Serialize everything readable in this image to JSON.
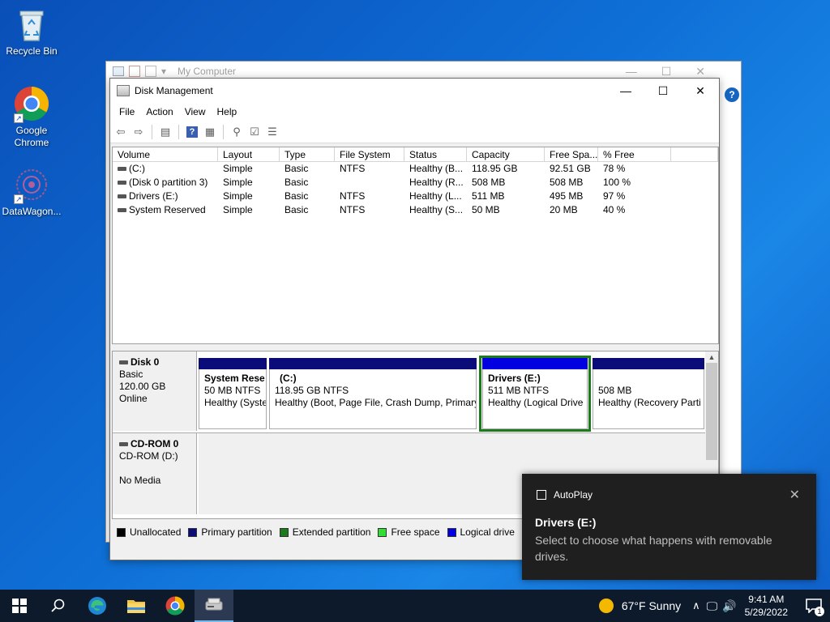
{
  "desktop": {
    "icons": [
      {
        "label": "Recycle Bin"
      },
      {
        "label": "Google Chrome"
      },
      {
        "label": "DataWagon..."
      }
    ]
  },
  "back_window": {
    "title": "My Computer"
  },
  "window": {
    "title": "Disk Management",
    "menu": [
      "File",
      "Action",
      "View",
      "Help"
    ]
  },
  "volumes": {
    "columns": [
      "Volume",
      "Layout",
      "Type",
      "File System",
      "Status",
      "Capacity",
      "Free Spa...",
      "% Free"
    ],
    "rows": [
      [
        "(C:)",
        "Simple",
        "Basic",
        "NTFS",
        "Healthy (B...",
        "118.95 GB",
        "92.51 GB",
        "78 %"
      ],
      [
        "(Disk 0 partition 3)",
        "Simple",
        "Basic",
        "",
        "Healthy (R...",
        "508 MB",
        "508 MB",
        "100 %"
      ],
      [
        "Drivers (E:)",
        "Simple",
        "Basic",
        "NTFS",
        "Healthy (L...",
        "511 MB",
        "495 MB",
        "97 %"
      ],
      [
        "System Reserved",
        "Simple",
        "Basic",
        "NTFS",
        "Healthy (S...",
        "50 MB",
        "20 MB",
        "40 %"
      ]
    ]
  },
  "disk0": {
    "name": "Disk 0",
    "type": "Basic",
    "size": "120.00 GB",
    "state": "Online",
    "partitions": [
      {
        "name": "System Rese",
        "info": "50 MB NTFS",
        "status": "Healthy (Syste"
      },
      {
        "name": "(C:)",
        "info": "118.95 GB NTFS",
        "status": "Healthy (Boot, Page File, Crash Dump, Primary"
      },
      {
        "name": "Drivers  (E:)",
        "info": "511 MB NTFS",
        "status": "Healthy (Logical Drive"
      },
      {
        "name": "",
        "info": "508 MB",
        "status": "Healthy (Recovery Parti"
      }
    ]
  },
  "cdrom": {
    "name": "CD-ROM 0",
    "type": "CD-ROM (D:)",
    "state": "No Media"
  },
  "legend": [
    {
      "label": "Unallocated",
      "color": "#000000"
    },
    {
      "label": "Primary partition",
      "color": "#0b0b7a"
    },
    {
      "label": "Extended partition",
      "color": "#1d7a1d"
    },
    {
      "label": "Free space",
      "color": "#33dd33"
    },
    {
      "label": "Logical drive",
      "color": "#0000e0"
    }
  ],
  "toast": {
    "app": "AutoPlay",
    "title": "Drivers (E:)",
    "body": "Select to choose what happens with removable drives."
  },
  "taskbar": {
    "weather": "67°F  Sunny",
    "time": "9:41 AM",
    "date": "5/29/2022",
    "notification_count": "1"
  }
}
